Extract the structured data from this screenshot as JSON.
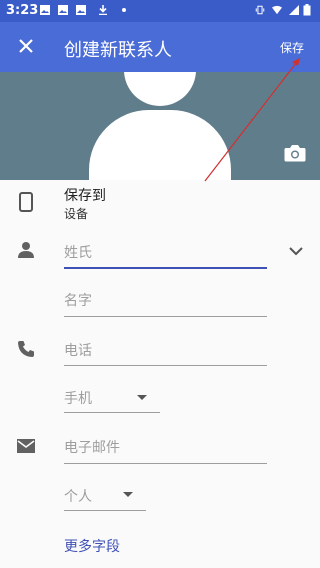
{
  "status": {
    "time": "3:23"
  },
  "appbar": {
    "title": "创建新联系人",
    "save_label": "保存"
  },
  "account": {
    "label": "保存到",
    "value": "设备"
  },
  "fields": {
    "last_name_placeholder": "姓氏",
    "first_name_placeholder": "名字",
    "phone_placeholder": "电话",
    "phone_type": "手机",
    "email_placeholder": "电子邮件",
    "email_type": "个人"
  },
  "more_fields": "更多字段",
  "colors": {
    "status_bar": "#3a5cc9",
    "app_bar": "#4a6cd6",
    "photo_bg": "#607d8b",
    "accent": "#3f51b5",
    "annotation_arrow": "#d32f2f"
  }
}
